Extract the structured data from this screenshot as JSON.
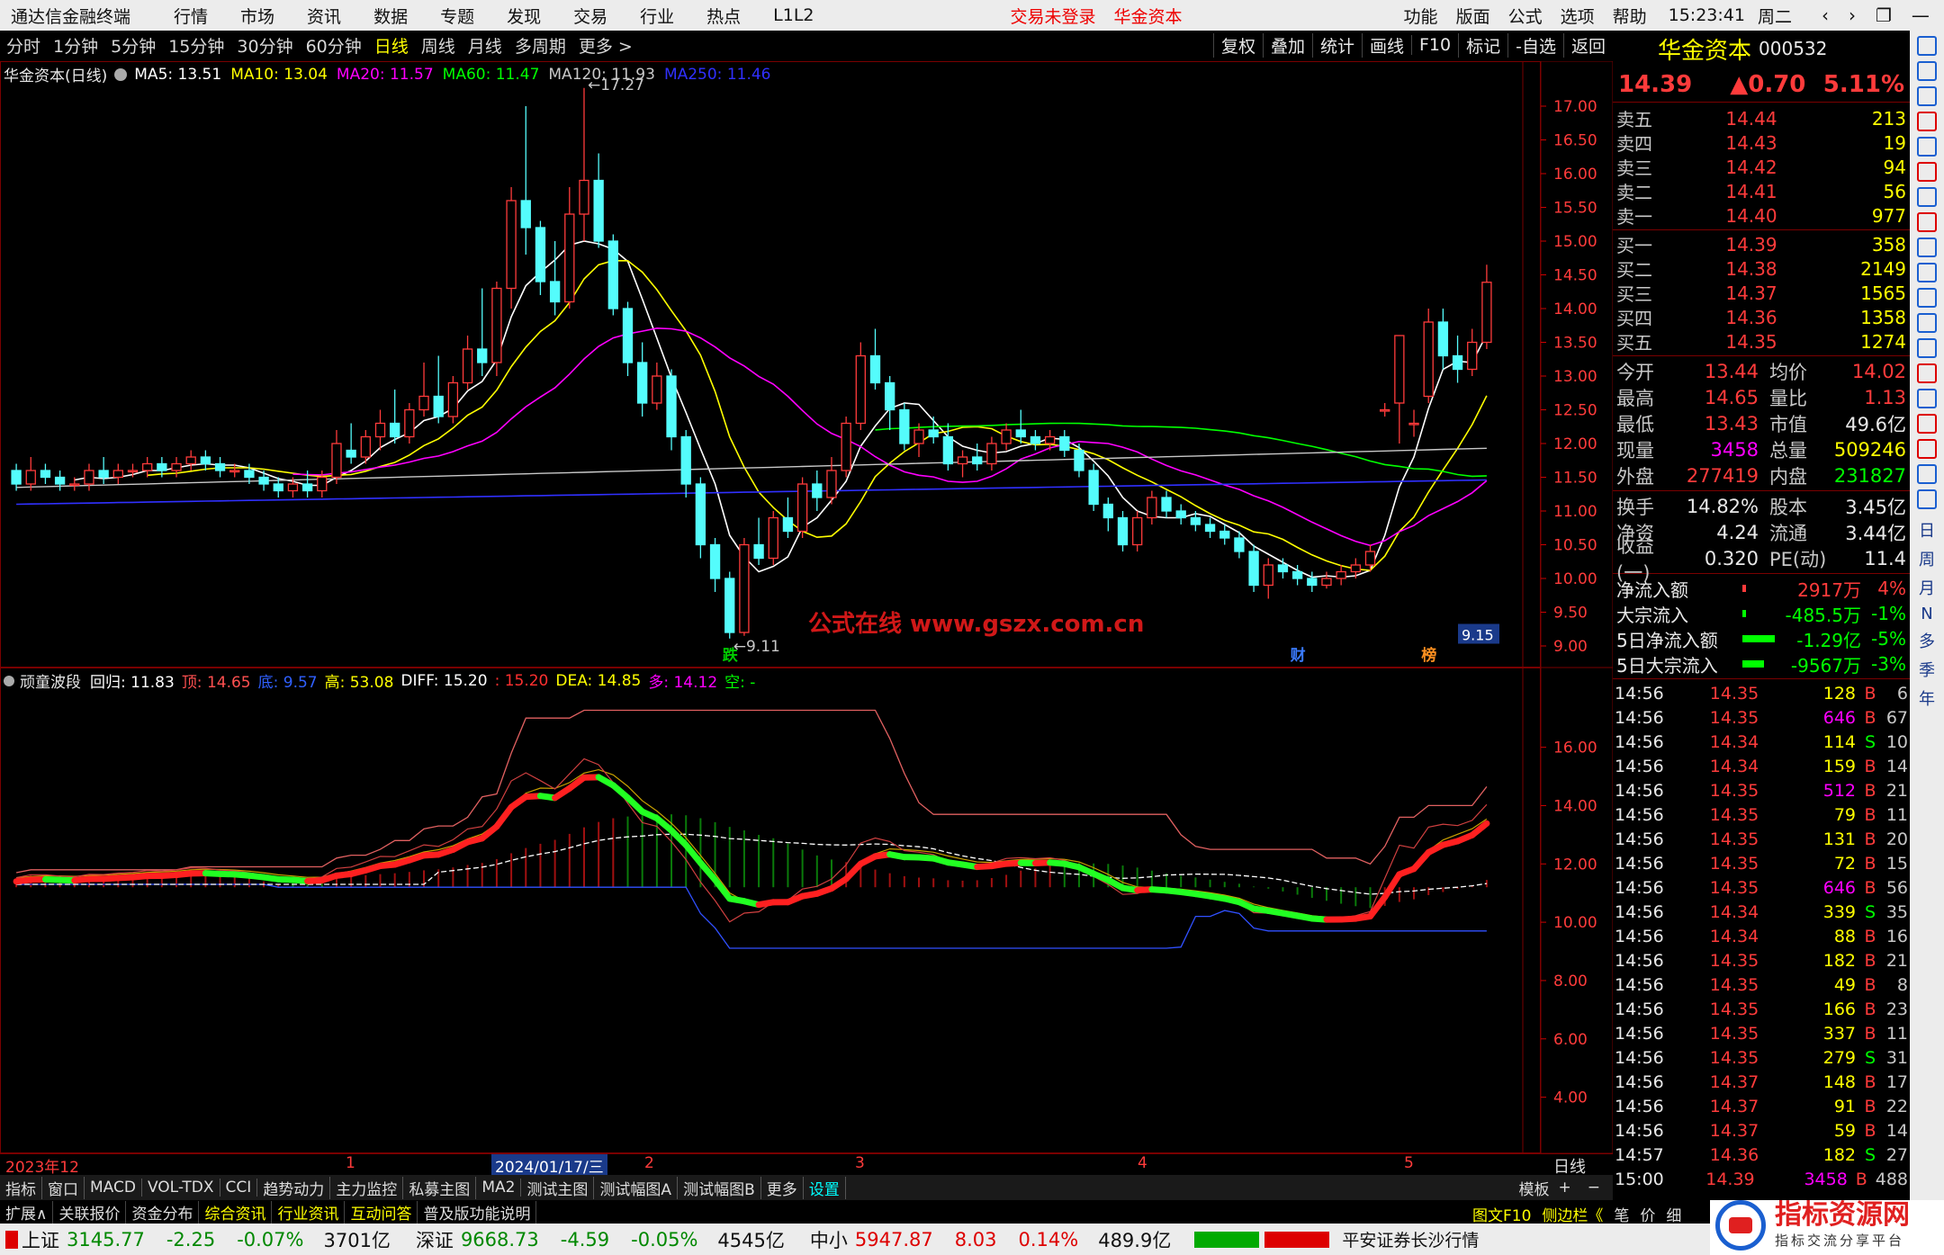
{
  "app": {
    "title": "通达信金融终端",
    "menu": [
      "行情",
      "市场",
      "资讯",
      "数据",
      "专题",
      "发现",
      "交易",
      "行业",
      "热点",
      "L1L2"
    ],
    "login_status": "交易未登录",
    "broker": "华金资本",
    "right_menu": [
      "功能",
      "版面",
      "公式",
      "选项",
      "帮助"
    ],
    "time": "15:23:41",
    "weekday": "周二",
    "nav_buttons": [
      "‹",
      "›",
      "❐",
      "—",
      "▭",
      "✕"
    ]
  },
  "periods": [
    "分时",
    "1分钟",
    "5分钟",
    "15分钟",
    "30分钟",
    "60分钟",
    "日线",
    "周线",
    "月线",
    "多周期",
    "更多 >"
  ],
  "active_period": "日线",
  "toolbar_buttons": [
    "复权",
    "叠加",
    "统计",
    "画线",
    "F10",
    "标记",
    "-自选",
    "返回"
  ],
  "main_chart": {
    "title": "华金资本(日线)",
    "ma": [
      {
        "label": "MA5: 13.51",
        "color": "#ffffff"
      },
      {
        "label": "MA10: 13.04",
        "color": "#ffff00"
      },
      {
        "label": "MA20: 11.57",
        "color": "#ff00ff"
      },
      {
        "label": "MA60: 11.47",
        "color": "#00ff00"
      },
      {
        "label": "MA120: 11.93",
        "color": "#c8c8c8"
      },
      {
        "label": "MA250: 11.46",
        "color": "#3030ff"
      }
    ],
    "y_ticks": [
      "17.00",
      "16.50",
      "16.00",
      "15.50",
      "15.00",
      "14.50",
      "14.00",
      "13.50",
      "13.00",
      "12.50",
      "12.00",
      "11.50",
      "11.00",
      "10.50",
      "10.00",
      "9.50",
      "9.00"
    ],
    "ylim": [
      9.0,
      17.0
    ],
    "high_marker": "17.27",
    "low_marker": "9.11",
    "price_tag": "9.15",
    "watermark": "公式在线  www.gszx.com.cn",
    "event_tags": [
      "跌",
      "财",
      "榜"
    ]
  },
  "sub_chart": {
    "title": "顽童波段",
    "fields": [
      {
        "label": "回归: 11.83",
        "color": "#ffffff"
      },
      {
        "label": "顶: 14.65",
        "color": "#ff5050"
      },
      {
        "label": "底: 9.57",
        "color": "#3060ff"
      },
      {
        "label": "高: 53.08",
        "color": "#ffff00"
      },
      {
        "label": "DIFF: 15.20",
        "color": "#ffffff"
      },
      {
        "label": ": 15.20",
        "color": "#ff3030"
      },
      {
        "label": "DEA: 14.85",
        "color": "#ffff00"
      },
      {
        "label": "多: 14.12",
        "color": "#ff00ff"
      },
      {
        "label": "空: -",
        "color": "#00ff00"
      }
    ],
    "y_ticks": [
      "16.00",
      "14.00",
      "12.00",
      "10.00",
      "8.00",
      "6.00",
      "4.00"
    ],
    "ylim": [
      3.0,
      17.5
    ]
  },
  "date_axis": {
    "labels": [
      "2023年12",
      "1",
      "2024/01/17/三",
      "2",
      "3",
      "4",
      "5"
    ],
    "period_label": "日线"
  },
  "chart_data": {
    "type": "candlestick",
    "ohlc": [
      [
        11.6,
        11.7,
        11.3,
        11.4
      ],
      [
        11.4,
        11.8,
        11.3,
        11.6
      ],
      [
        11.6,
        11.7,
        11.4,
        11.5
      ],
      [
        11.5,
        11.6,
        11.3,
        11.4
      ],
      [
        11.4,
        11.5,
        11.3,
        11.4
      ],
      [
        11.4,
        11.7,
        11.3,
        11.6
      ],
      [
        11.6,
        11.8,
        11.4,
        11.5
      ],
      [
        11.5,
        11.7,
        11.4,
        11.6
      ],
      [
        11.6,
        11.7,
        11.5,
        11.6
      ],
      [
        11.6,
        11.8,
        11.5,
        11.7
      ],
      [
        11.7,
        11.8,
        11.5,
        11.6
      ],
      [
        11.6,
        11.8,
        11.5,
        11.7
      ],
      [
        11.7,
        11.9,
        11.6,
        11.8
      ],
      [
        11.8,
        11.9,
        11.6,
        11.7
      ],
      [
        11.7,
        11.8,
        11.5,
        11.6
      ],
      [
        11.6,
        11.7,
        11.5,
        11.6
      ],
      [
        11.6,
        11.7,
        11.4,
        11.5
      ],
      [
        11.5,
        11.6,
        11.3,
        11.4
      ],
      [
        11.4,
        11.5,
        11.2,
        11.3
      ],
      [
        11.3,
        11.5,
        11.2,
        11.4
      ],
      [
        11.4,
        11.6,
        11.2,
        11.3
      ],
      [
        11.3,
        11.6,
        11.2,
        11.5
      ],
      [
        11.5,
        12.2,
        11.4,
        12.0
      ],
      [
        11.9,
        12.3,
        11.7,
        11.8
      ],
      [
        11.8,
        12.2,
        11.7,
        12.1
      ],
      [
        12.1,
        12.5,
        11.9,
        12.3
      ],
      [
        12.3,
        12.8,
        12.0,
        12.1
      ],
      [
        12.1,
        12.6,
        12.0,
        12.5
      ],
      [
        12.5,
        13.2,
        12.4,
        12.7
      ],
      [
        12.7,
        13.3,
        12.3,
        12.4
      ],
      [
        12.4,
        13.0,
        12.3,
        12.9
      ],
      [
        12.9,
        13.6,
        12.8,
        13.4
      ],
      [
        13.4,
        14.3,
        13.0,
        13.2
      ],
      [
        13.2,
        14.4,
        13.0,
        14.3
      ],
      [
        14.3,
        15.8,
        14.0,
        15.6
      ],
      [
        15.6,
        17.0,
        14.8,
        15.2
      ],
      [
        15.2,
        15.3,
        14.2,
        14.4
      ],
      [
        14.4,
        15.0,
        13.9,
        14.1
      ],
      [
        14.1,
        15.8,
        14.0,
        15.4
      ],
      [
        15.4,
        17.27,
        15.0,
        15.9
      ],
      [
        15.9,
        16.3,
        14.9,
        15.0
      ],
      [
        15.0,
        15.1,
        13.9,
        14.0
      ],
      [
        14.0,
        14.1,
        13.0,
        13.2
      ],
      [
        13.2,
        13.5,
        12.4,
        12.6
      ],
      [
        12.6,
        13.2,
        12.5,
        13.0
      ],
      [
        13.0,
        13.1,
        11.9,
        12.1
      ],
      [
        12.1,
        12.2,
        11.2,
        11.4
      ],
      [
        11.4,
        11.5,
        10.3,
        10.5
      ],
      [
        10.5,
        10.6,
        9.8,
        10.0
      ],
      [
        10.0,
        10.1,
        9.11,
        9.2
      ],
      [
        9.2,
        10.6,
        9.15,
        10.5
      ],
      [
        10.5,
        10.9,
        10.2,
        10.3
      ],
      [
        10.3,
        11.0,
        10.2,
        10.9
      ],
      [
        10.9,
        11.2,
        10.6,
        10.7
      ],
      [
        10.7,
        11.5,
        10.6,
        11.4
      ],
      [
        11.4,
        11.6,
        11.0,
        11.2
      ],
      [
        11.2,
        11.8,
        11.1,
        11.6
      ],
      [
        11.6,
        12.4,
        11.5,
        12.3
      ],
      [
        12.3,
        13.5,
        12.2,
        13.3
      ],
      [
        13.3,
        13.7,
        12.8,
        12.9
      ],
      [
        12.9,
        13.0,
        12.2,
        12.5
      ],
      [
        12.5,
        12.6,
        11.9,
        12.0
      ],
      [
        12.0,
        12.3,
        11.8,
        12.2
      ],
      [
        12.2,
        12.4,
        12.0,
        12.1
      ],
      [
        12.1,
        12.3,
        11.6,
        11.7
      ],
      [
        11.7,
        11.9,
        11.5,
        11.8
      ],
      [
        11.8,
        12.0,
        11.6,
        11.7
      ],
      [
        11.7,
        12.1,
        11.6,
        12.0
      ],
      [
        12.0,
        12.3,
        11.9,
        12.2
      ],
      [
        12.2,
        12.5,
        12.0,
        12.1
      ],
      [
        12.1,
        12.2,
        11.9,
        12.0
      ],
      [
        12.0,
        12.2,
        11.9,
        12.1
      ],
      [
        12.1,
        12.2,
        11.8,
        11.9
      ],
      [
        11.9,
        12.0,
        11.5,
        11.6
      ],
      [
        11.6,
        11.7,
        11.0,
        11.1
      ],
      [
        11.1,
        11.2,
        10.7,
        10.9
      ],
      [
        10.9,
        11.0,
        10.4,
        10.5
      ],
      [
        10.5,
        11.0,
        10.4,
        10.9
      ],
      [
        10.9,
        11.3,
        10.8,
        11.2
      ],
      [
        11.2,
        11.3,
        10.9,
        11.0
      ],
      [
        11.0,
        11.1,
        10.8,
        10.9
      ],
      [
        10.9,
        11.0,
        10.7,
        10.8
      ],
      [
        10.8,
        10.9,
        10.6,
        10.7
      ],
      [
        10.7,
        10.8,
        10.5,
        10.6
      ],
      [
        10.6,
        10.7,
        10.3,
        10.4
      ],
      [
        10.4,
        10.5,
        9.8,
        9.9
      ],
      [
        9.9,
        10.3,
        9.7,
        10.2
      ],
      [
        10.2,
        10.3,
        10.0,
        10.1
      ],
      [
        10.1,
        10.2,
        9.9,
        10.0
      ],
      [
        10.0,
        10.1,
        9.8,
        9.9
      ],
      [
        9.9,
        10.1,
        9.85,
        10.0
      ],
      [
        10.0,
        10.2,
        9.9,
        10.1
      ],
      [
        10.1,
        10.3,
        10.0,
        10.2
      ],
      [
        10.2,
        10.5,
        10.1,
        10.4
      ],
      [
        12.5,
        12.6,
        12.4,
        12.5
      ],
      [
        12.6,
        13.6,
        12.0,
        13.6
      ],
      [
        12.3,
        12.5,
        12.1,
        12.3
      ],
      [
        12.7,
        14.0,
        12.6,
        13.8
      ],
      [
        13.8,
        14.0,
        13.1,
        13.3
      ],
      [
        13.3,
        13.6,
        12.9,
        13.1
      ],
      [
        13.1,
        13.7,
        13.0,
        13.5
      ],
      [
        13.5,
        14.65,
        13.4,
        14.39
      ]
    ]
  },
  "quote": {
    "name": "华金资本",
    "code": "000532",
    "price": "14.39",
    "change": "▲0.70",
    "pct": "5.11%",
    "asks": [
      {
        "label": "卖五",
        "price": "14.44",
        "vol": "213"
      },
      {
        "label": "卖四",
        "price": "14.43",
        "vol": "19"
      },
      {
        "label": "卖三",
        "price": "14.42",
        "vol": "94"
      },
      {
        "label": "卖二",
        "price": "14.41",
        "vol": "56"
      },
      {
        "label": "卖一",
        "price": "14.40",
        "vol": "977"
      }
    ],
    "bids": [
      {
        "label": "买一",
        "price": "14.39",
        "vol": "358"
      },
      {
        "label": "买二",
        "price": "14.38",
        "vol": "2149"
      },
      {
        "label": "买三",
        "price": "14.37",
        "vol": "1565"
      },
      {
        "label": "买四",
        "price": "14.36",
        "vol": "1358"
      },
      {
        "label": "买五",
        "price": "14.35",
        "vol": "1274"
      }
    ],
    "stats1": [
      {
        "k": "今开",
        "v": "13.44",
        "vc": "#ff3b3b",
        "k2": "均价",
        "v2": "14.02",
        "v2c": "#ff3b3b"
      },
      {
        "k": "最高",
        "v": "14.65",
        "vc": "#ff3b3b",
        "k2": "量比",
        "v2": "1.13",
        "v2c": "#ff3b3b"
      },
      {
        "k": "最低",
        "v": "13.43",
        "vc": "#ff3b3b",
        "k2": "市值",
        "v2": "49.6亿",
        "v2c": "#e8e8e8"
      },
      {
        "k": "现量",
        "v": "3458",
        "vc": "#ff00ff",
        "k2": "总量",
        "v2": "509246",
        "v2c": "#ffff00"
      },
      {
        "k": "外盘",
        "v": "277419",
        "vc": "#ff3b3b",
        "k2": "内盘",
        "v2": "231827",
        "v2c": "#00ff00"
      }
    ],
    "stats2": [
      {
        "k": "换手",
        "v": "14.82%",
        "vc": "#e8e8e8",
        "k2": "股本",
        "v2": "3.45亿",
        "v2c": "#e8e8e8"
      },
      {
        "k": "净资",
        "v": "4.24",
        "vc": "#e8e8e8",
        "k2": "流通",
        "v2": "3.44亿",
        "v2c": "#e8e8e8"
      },
      {
        "k": "收益(一)",
        "v": "0.320",
        "vc": "#e8e8e8",
        "k2": "PE(动)",
        "v2": "11.4",
        "v2c": "#e8e8e8"
      }
    ],
    "flows": [
      {
        "label": "净流入额",
        "value": "2917万",
        "pct": "4%",
        "color": "#ff3b3b",
        "bar": 0.03
      },
      {
        "label": "大宗流入",
        "value": "-485.5万",
        "pct": "-1%",
        "color": "#00ff00",
        "bar": 0.01
      },
      {
        "label": "5日净流入额",
        "value": "-1.29亿",
        "pct": "-5%",
        "color": "#00ff00",
        "bar": 0.3
      },
      {
        "label": "5日大宗流入",
        "value": "-9567万",
        "pct": "-3%",
        "color": "#00ff00",
        "bar": 0.2
      }
    ],
    "ticks": [
      {
        "t": "14:56",
        "p": "14.35",
        "v": "128",
        "s": "B",
        "n": "6"
      },
      {
        "t": "14:56",
        "p": "14.35",
        "v": "646",
        "s": "B",
        "n": "67"
      },
      {
        "t": "14:56",
        "p": "14.34",
        "v": "114",
        "s": "S",
        "n": "10"
      },
      {
        "t": "14:56",
        "p": "14.34",
        "v": "159",
        "s": "B",
        "n": "14"
      },
      {
        "t": "14:56",
        "p": "14.35",
        "v": "512",
        "s": "B",
        "n": "21"
      },
      {
        "t": "14:56",
        "p": "14.35",
        "v": "79",
        "s": "B",
        "n": "11"
      },
      {
        "t": "14:56",
        "p": "14.35",
        "v": "131",
        "s": "B",
        "n": "20"
      },
      {
        "t": "14:56",
        "p": "14.35",
        "v": "72",
        "s": "B",
        "n": "15"
      },
      {
        "t": "14:56",
        "p": "14.35",
        "v": "646",
        "s": "B",
        "n": "56"
      },
      {
        "t": "14:56",
        "p": "14.34",
        "v": "339",
        "s": "S",
        "n": "35"
      },
      {
        "t": "14:56",
        "p": "14.34",
        "v": "88",
        "s": "B",
        "n": "16"
      },
      {
        "t": "14:56",
        "p": "14.35",
        "v": "182",
        "s": "B",
        "n": "21"
      },
      {
        "t": "14:56",
        "p": "14.35",
        "v": "49",
        "s": "B",
        "n": "8"
      },
      {
        "t": "14:56",
        "p": "14.35",
        "v": "166",
        "s": "B",
        "n": "23"
      },
      {
        "t": "14:56",
        "p": "14.35",
        "v": "337",
        "s": "B",
        "n": "11"
      },
      {
        "t": "14:56",
        "p": "14.35",
        "v": "279",
        "s": "S",
        "n": "31"
      },
      {
        "t": "14:56",
        "p": "14.37",
        "v": "148",
        "s": "B",
        "n": "17"
      },
      {
        "t": "14:56",
        "p": "14.37",
        "v": "91",
        "s": "B",
        "n": "22"
      },
      {
        "t": "14:56",
        "p": "14.37",
        "v": "59",
        "s": "B",
        "n": "14"
      },
      {
        "t": "14:57",
        "p": "14.36",
        "v": "182",
        "s": "S",
        "n": "27"
      },
      {
        "t": "15:00",
        "p": "14.39",
        "v": "3458",
        "s": "B",
        "n": "488"
      }
    ]
  },
  "side_strip": [
    "日",
    "周",
    "月",
    "N",
    "多",
    "季",
    "年"
  ],
  "bottom_tabs": [
    "指标",
    "窗口",
    "MACD",
    "VOL-TDX",
    "CCI",
    "趋势动力",
    "主力监控",
    "私募主图",
    "MA2",
    "测试主图",
    "测试幅图A",
    "测试幅图B",
    "更多",
    "设置"
  ],
  "template_btn": "模板",
  "links": [
    "扩展∧",
    "关联报价",
    "资金分布",
    "综合资讯",
    "行业资讯",
    "互动问答",
    "普及版功能说明"
  ],
  "links_right": [
    "图文F10",
    "侧边栏《",
    "笔",
    "价",
    "细"
  ],
  "status": {
    "sh_label": "上证",
    "sh_val": "3145.77",
    "sh_chg": "-2.25",
    "sh_pct": "-0.07%",
    "sh_amt": "3701亿",
    "sz_label": "深证",
    "sz_val": "9668.73",
    "sz_chg": "-4.59",
    "sz_pct": "-0.05%",
    "sz_amt": "4545亿",
    "zx_label": "中小",
    "zx_val": "5947.87",
    "zx_chg": "8.03",
    "zx_pct": "0.14%",
    "zx_amt": "489.9亿",
    "source": "平安证券长沙行情"
  },
  "brand_badge": {
    "title": "指标资源网",
    "subtitle": "指标交流分享平台"
  }
}
